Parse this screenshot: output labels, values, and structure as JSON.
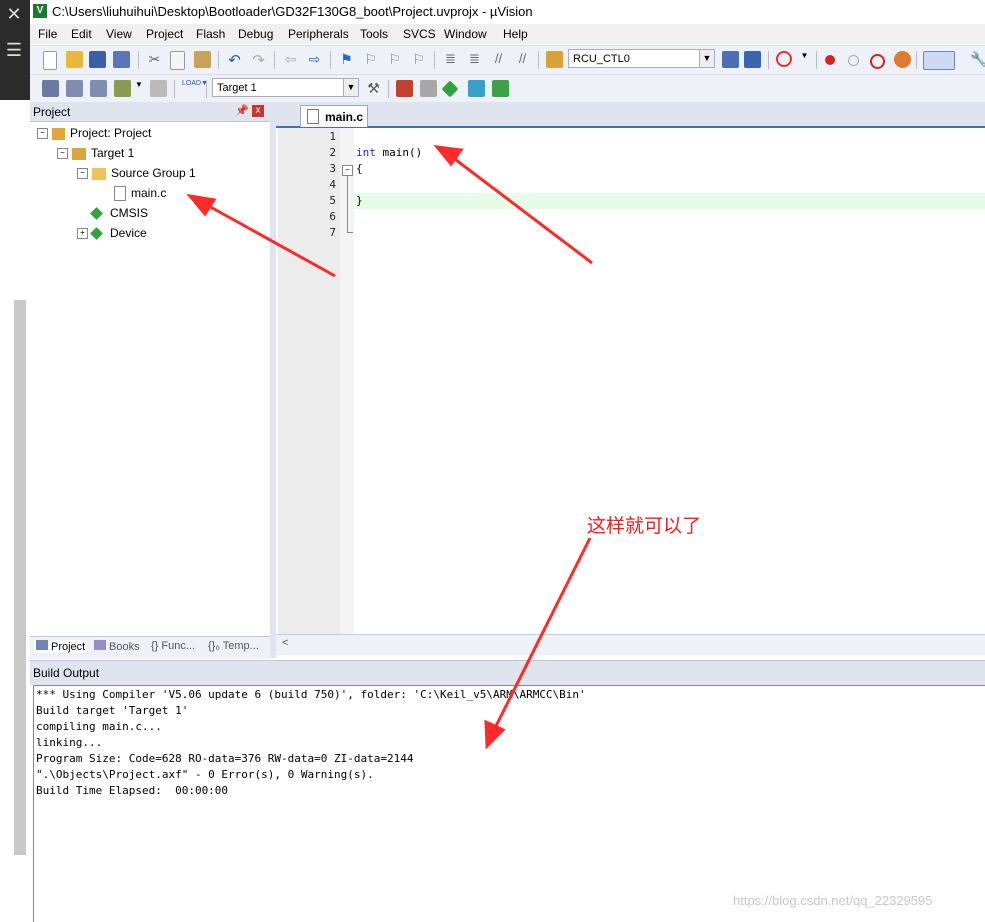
{
  "window": {
    "title": "C:\\Users\\liuhuihui\\Desktop\\Bootloader\\GD32F130G8_boot\\Project.uvprojx - µVision",
    "app_icon": "keil-logo-icon"
  },
  "menu": [
    "File",
    "Edit",
    "View",
    "Project",
    "Flash",
    "Debug",
    "Peripherals",
    "Tools",
    "SVCS",
    "Window",
    "Help"
  ],
  "toolbar1": {
    "combo_value": "RCU_CTL0"
  },
  "toolbar2": {
    "target_combo": "Target 1"
  },
  "project_panel": {
    "title": "Project",
    "pin": "⊕",
    "close": "x",
    "tree": {
      "root": "Project: Project",
      "target": "Target 1",
      "group": "Source Group 1",
      "file": "main.c",
      "cmsis": "CMSIS",
      "device": "Device"
    },
    "tabs": [
      "Project",
      "Books",
      "{} Func...",
      "{}₀ Temp..."
    ]
  },
  "editor": {
    "tab": "main.c",
    "line_numbers": [
      "1",
      "2",
      "3",
      "4",
      "5",
      "6",
      "7"
    ],
    "code": {
      "line2_kw": "int",
      "line2_rest": " main()",
      "line3": "{",
      "line5": "}"
    }
  },
  "build_output": {
    "title": "Build Output",
    "lines": [
      "*** Using Compiler 'V5.06 update 6 (build 750)', folder: 'C:\\Keil_v5\\ARM\\ARMCC\\Bin'",
      "Build target 'Target 1'",
      "compiling main.c...",
      "linking...",
      "Program Size: Code=628 RO-data=376 RW-data=0 ZI-data=2144",
      "\".\\Objects\\Project.axf\" - 0 Error(s), 0 Warning(s).",
      "Build Time Elapsed:  00:00:00"
    ]
  },
  "annotation": {
    "text": "这样就可以了",
    "color": "#ff1a1a"
  },
  "watermark": "https://blog.csdn.net/qq_22329595"
}
